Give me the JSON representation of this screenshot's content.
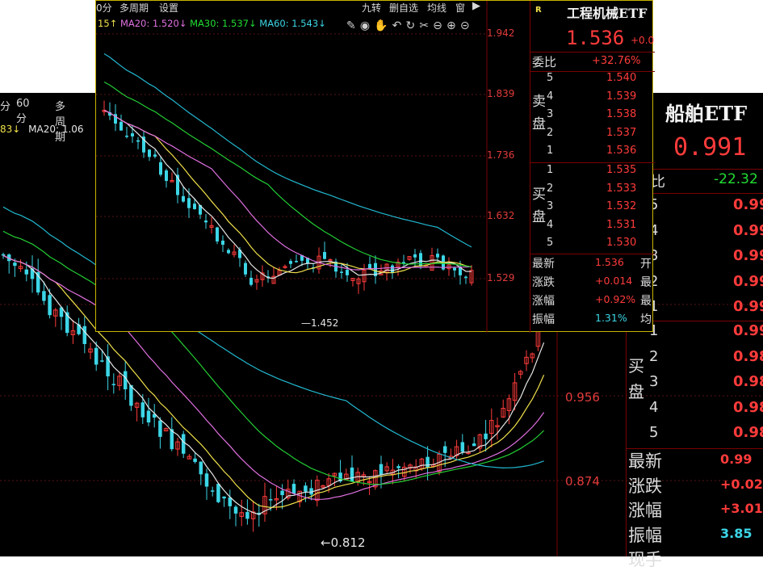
{
  "back": {
    "toolbar": [
      "分",
      "60分",
      "多周期"
    ],
    "ma_labels": {
      "a": "83↓",
      "b": "MA20: 1.06"
    },
    "yticks": [
      "0.956",
      "0.874"
    ],
    "low_label": "0.812",
    "quote": {
      "title": "船舶ETF",
      "price": "0.991",
      "wei_label": "比",
      "wei_val": "-22.32",
      "asks": [
        {
          "n": "5",
          "p": "0.99"
        },
        {
          "n": "4",
          "p": "0.99"
        },
        {
          "n": "3",
          "p": "0.99"
        },
        {
          "n": "2",
          "p": "0.99"
        },
        {
          "n": "1",
          "p": "0.99"
        }
      ],
      "bids": [
        {
          "n": "1",
          "p": "0.99"
        },
        {
          "n": "2",
          "p": "0.98"
        },
        {
          "n": "3",
          "p": "0.98"
        },
        {
          "n": "4",
          "p": "0.98"
        },
        {
          "n": "5",
          "p": "0.98"
        }
      ],
      "bid_side": [
        "买",
        "盘"
      ],
      "stats": [
        {
          "k": "最新",
          "v": "0.99",
          "c": "#ff3b3b"
        },
        {
          "k": "涨跌",
          "v": "+0.02",
          "c": "#ff3b3b"
        },
        {
          "k": "涨幅",
          "v": "+3.01",
          "c": "#ff3b3b"
        },
        {
          "k": "振幅",
          "v": "3.85",
          "c": "#3cd6e6"
        },
        {
          "k": "现手",
          "v": ""
        }
      ]
    }
  },
  "front": {
    "toolbar": {
      "left": [
        "0分",
        "多周期",
        "设置"
      ],
      "right": [
        "九转",
        "删自选",
        "均线",
        "窗"
      ]
    },
    "ma_labels": {
      "a": "15↑",
      "ma20": "MA20: 1.520↓",
      "ma30": "MA30: 1.537↓",
      "ma60": "MA60: 1.543↓"
    },
    "yticks": [
      "1.942",
      "1.839",
      "1.736",
      "1.632",
      "1.529"
    ],
    "low_label": "1.452",
    "quote": {
      "title": "工程机械ETF",
      "badge": "R",
      "price": "1.536",
      "change": "+0.0",
      "wei_label": "委比",
      "wei_val": "+32.76%",
      "sell_side": [
        "卖",
        "盘"
      ],
      "buy_side": [
        "买",
        "盘"
      ],
      "asks": [
        {
          "n": "5",
          "p": "1.540"
        },
        {
          "n": "4",
          "p": "1.539"
        },
        {
          "n": "3",
          "p": "1.538"
        },
        {
          "n": "2",
          "p": "1.537"
        },
        {
          "n": "1",
          "p": "1.536"
        }
      ],
      "bids": [
        {
          "n": "1",
          "p": "1.535"
        },
        {
          "n": "2",
          "p": "1.533"
        },
        {
          "n": "3",
          "p": "1.532"
        },
        {
          "n": "4",
          "p": "1.531"
        },
        {
          "n": "5",
          "p": "1.530"
        }
      ],
      "stats": [
        {
          "k": "最新",
          "v": "1.536",
          "c": "#ff3b3b",
          "r": "开"
        },
        {
          "k": "涨跌",
          "v": "+0.014",
          "c": "#ff3b3b",
          "r": "最"
        },
        {
          "k": "涨幅",
          "v": "+0.92%",
          "c": "#ff3b3b",
          "r": "最"
        },
        {
          "k": "振幅",
          "v": "1.31%",
          "c": "#3cd6e6",
          "r": "均"
        }
      ]
    }
  },
  "colors": {
    "up": "#ff3b3b",
    "down": "#3cd6e6",
    "ma_white": "#e6e6e6",
    "ma_yellow": "#f0e04a",
    "ma_pink": "#e070e0",
    "ma_green": "#22cc33",
    "ma_cyan": "#22b8d0",
    "border": "#c9b400"
  }
}
